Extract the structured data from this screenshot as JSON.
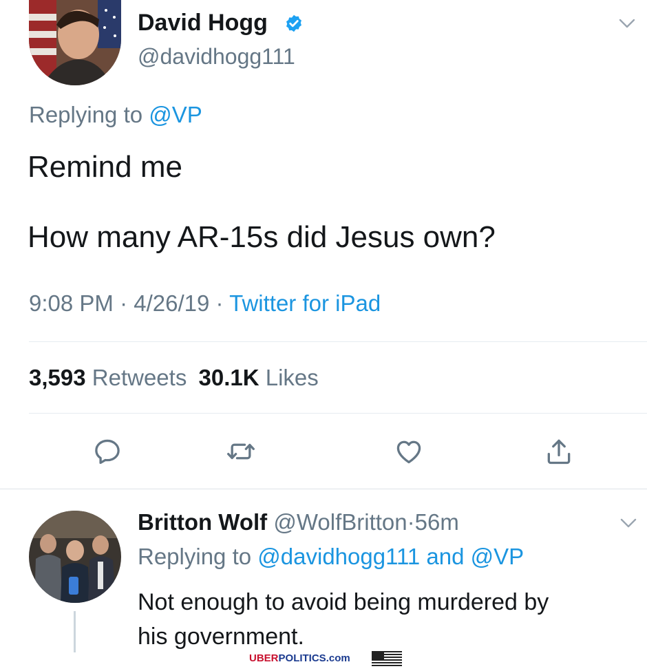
{
  "tweet": {
    "author_name": "David Hogg",
    "author_handle": "@davidhogg111",
    "replying_prefix": "Replying to",
    "replying_handle": "@VP",
    "text_line1": "Remind me",
    "text_line2": "How many AR-15s did Jesus own?",
    "time": "9:08 PM",
    "date": "4/26/19",
    "sep": "·",
    "source": "Twitter for iPad",
    "retweets_count": "3,593",
    "retweets_label": "Retweets",
    "likes_count": "30.1K",
    "likes_label": "Likes",
    "icons": {
      "verified": "verified-badge-icon",
      "chevron": "chevron-down-icon",
      "reply": "reply-icon",
      "retweet": "retweet-icon",
      "like": "heart-icon",
      "share": "share-icon"
    }
  },
  "reply": {
    "author_name": "Britton Wolf",
    "author_handle": "@WolfBritton",
    "sep": "·",
    "age": "56m",
    "replying_prefix": "Replying to",
    "replying_handle1": "@davidhogg111",
    "replying_and": "and",
    "replying_handle2": "@VP",
    "text_line1": "Not enough to avoid being murdered by",
    "text_line2": "his government."
  },
  "watermark": {
    "part1": "UBER",
    "part2": "POLITICS",
    "part3": ".com"
  },
  "colors": {
    "link": "#1b95e0",
    "muted": "#657786",
    "text": "#14171a",
    "verified": "#1da1f2",
    "watermark_red": "#c8102e",
    "watermark_blue": "#1a3a8f"
  }
}
